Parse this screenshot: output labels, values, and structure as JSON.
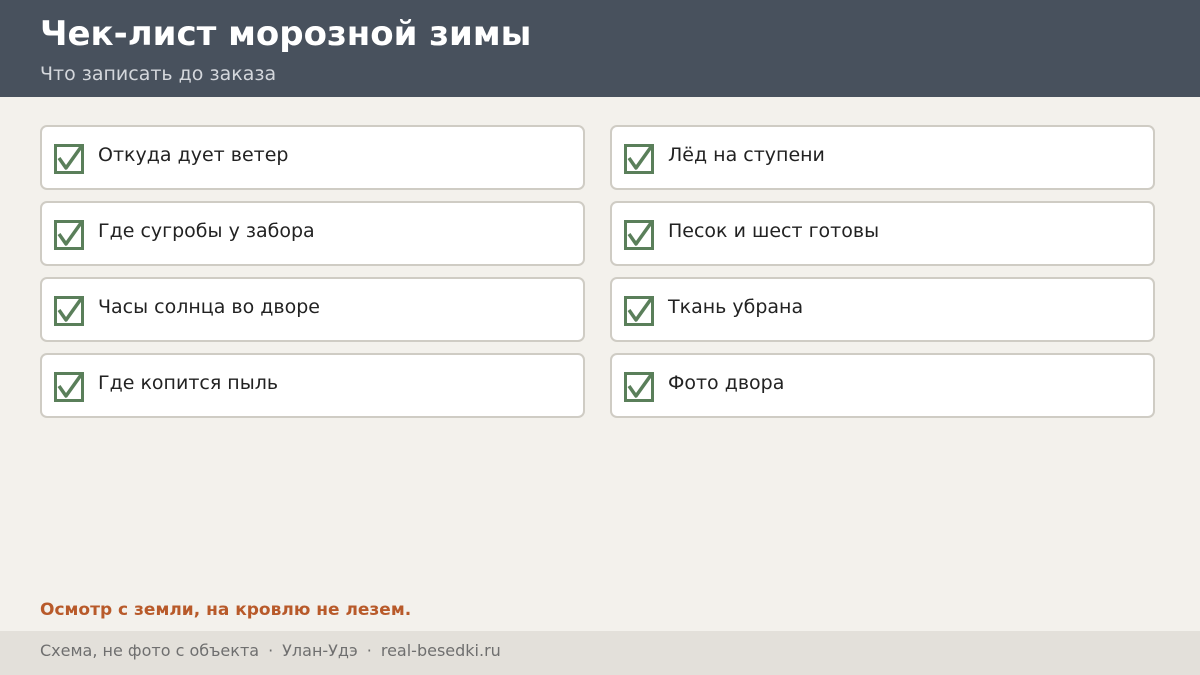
{
  "header": {
    "title": "Чек-лист морозной зимы",
    "subtitle": "Что записать до заказа"
  },
  "checklist": {
    "check_icon": "checkbox-checked-icon",
    "check_color": "#5a7f5a",
    "items": [
      {
        "label": "Откуда дует ветер",
        "checked": true
      },
      {
        "label": "Лёд на ступени",
        "checked": true
      },
      {
        "label": "Где сугробы у забора",
        "checked": true
      },
      {
        "label": "Песок и шест готовы",
        "checked": true
      },
      {
        "label": "Часы солнца во дворе",
        "checked": true
      },
      {
        "label": "Ткань убрана",
        "checked": true
      },
      {
        "label": "Где копится пыль",
        "checked": true
      },
      {
        "label": "Фото двора",
        "checked": true
      }
    ]
  },
  "note": "Осмотр с земли, на кровлю не лезем.",
  "footer": {
    "part1": "Схема, не фото с объекта",
    "separator": "·",
    "part2": "Улан-Удэ",
    "part3": "real-besedki.ru"
  },
  "colors": {
    "header_bg": "#48515d",
    "page_bg": "#f3f1ec",
    "accent_note": "#b85a2a",
    "footer_bg": "#e3e0da"
  }
}
